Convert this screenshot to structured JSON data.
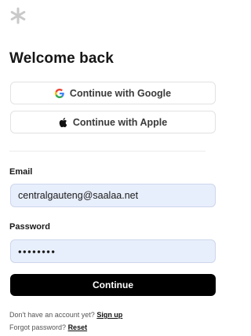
{
  "logo": {
    "icon": "asterisk-logo",
    "color": "#c9c9c9"
  },
  "heading": {
    "title": "Welcome back"
  },
  "oauth": {
    "google": {
      "label": "Continue with Google",
      "icon": "google-g-icon"
    },
    "apple": {
      "label": "Continue with Apple",
      "icon": "apple-icon"
    }
  },
  "form": {
    "email": {
      "label": "Email",
      "value": "centralgauteng@saalaa.net"
    },
    "password": {
      "label": "Password",
      "value": "••••••••"
    },
    "submit_label": "Continue"
  },
  "footer": {
    "signup_prompt": "Don't have an account yet?",
    "signup_link": "Sign up",
    "forgot_prompt": "Forgot password?",
    "reset_link": "Reset"
  },
  "colors": {
    "field_background": "#e8effc",
    "primary_button": "#000000",
    "border": "#e2e2e2"
  }
}
